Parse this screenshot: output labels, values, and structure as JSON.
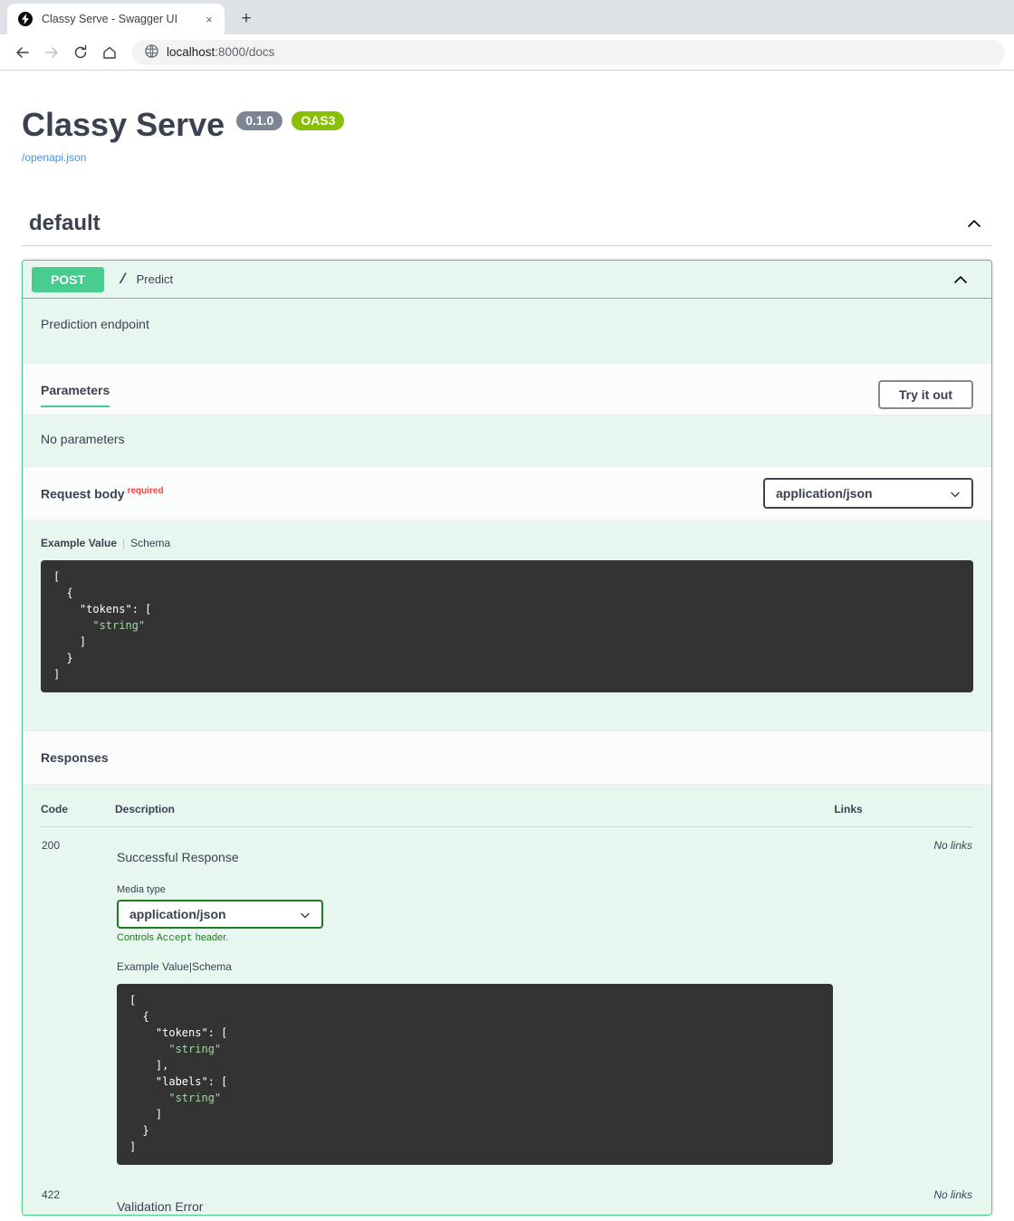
{
  "browser": {
    "tab": {
      "title": "Classy Serve - Swagger UI",
      "favicon": "lightning-bolt-icon",
      "close": "×"
    },
    "new_tab_label": "+",
    "nav": {
      "back": "←",
      "forward": "→",
      "reload": "↻",
      "home": "⌂"
    },
    "omnibox": {
      "icon": "globe-icon",
      "host": "localhost",
      "rest": ":8000/docs"
    }
  },
  "api": {
    "title": "Classy Serve",
    "version": "0.1.0",
    "spec_badge": "OAS3",
    "spec_url": "/openapi.json"
  },
  "tag": {
    "name": "default",
    "collapse_icon": "chevron-up-icon"
  },
  "operation": {
    "method": "POST",
    "path": "/",
    "summary": "Predict",
    "description": "Prediction endpoint",
    "collapse_icon": "chevron-up-icon",
    "parameters": {
      "tab_label": "Parameters",
      "try_it_out_label": "Try it out",
      "empty_text": "No parameters"
    },
    "request_body": {
      "label": "Request body",
      "required_label": "required",
      "content_type": "application/json",
      "example_tab": "Example Value",
      "schema_tab": "Schema",
      "example_code": "[\n  {\n    \"tokens\": [\n      \"string\"\n    ]\n  }\n]"
    },
    "responses": {
      "title": "Responses",
      "columns": {
        "code": "Code",
        "description": "Description",
        "links": "Links"
      },
      "rows": [
        {
          "code": "200",
          "description": "Successful Response",
          "links": "No links",
          "media_type_label": "Media type",
          "media_type": "application/json",
          "accept_note_pre": "Controls ",
          "accept_note_code": "Accept",
          "accept_note_post": " header.",
          "example_tab": "Example Value",
          "schema_tab": "Schema",
          "example_code": "[\n  {\n    \"tokens\": [\n      \"string\"\n    ],\n    \"labels\": [\n      \"string\"\n    ]\n  }\n]"
        },
        {
          "code": "422",
          "description": "Validation Error",
          "links": "No links"
        }
      ]
    }
  },
  "colors": {
    "post_green": "#49cc90",
    "opblock_bg": "#e8f6f0",
    "oas_green": "#89bf04",
    "version_grey": "#7d8492",
    "text": "#3b4151",
    "required_red": "#f93e3e",
    "link_blue": "#4990e2",
    "code_bg": "#333333",
    "code_string": "#a5d6a7",
    "accept_green": "#1f7a1f"
  }
}
